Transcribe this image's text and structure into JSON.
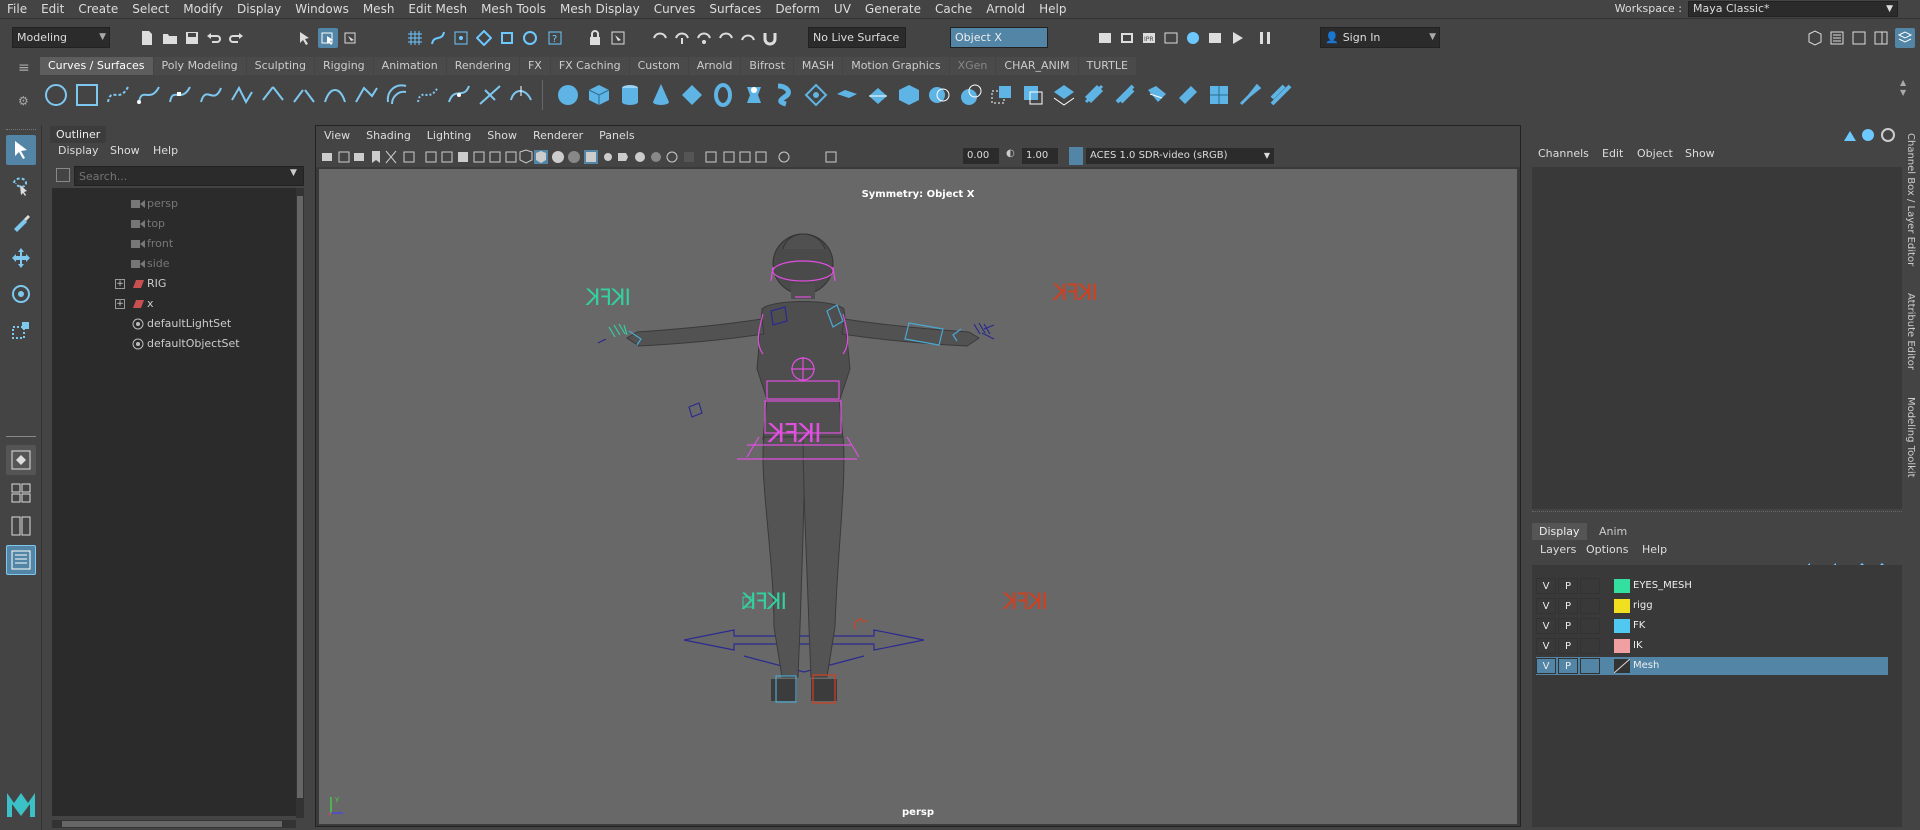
{
  "menubar": [
    "File",
    "Edit",
    "Create",
    "Select",
    "Modify",
    "Display",
    "Windows",
    "Mesh",
    "Edit Mesh",
    "Mesh Tools",
    "Mesh Display",
    "Curves",
    "Surfaces",
    "Deform",
    "UV",
    "Generate",
    "Cache",
    "Arnold",
    "Help"
  ],
  "workspace": {
    "label": "Workspace :",
    "value": "Maya Classic*"
  },
  "status": {
    "mode": "Modeling",
    "live_surface": "No Live Surface",
    "symmetry": "Object X",
    "sign_in": "Sign In"
  },
  "shelf_tabs": [
    "Curves / Surfaces",
    "Poly Modeling",
    "Sculpting",
    "Rigging",
    "Animation",
    "Rendering",
    "FX",
    "FX Caching",
    "Custom",
    "Arnold",
    "Bifrost",
    "MASH",
    "Motion Graphics",
    "XGen",
    "CHAR_ANIM",
    "TURTLE"
  ],
  "outliner": {
    "title": "Outliner",
    "menu": [
      "Display",
      "Show",
      "Help"
    ],
    "search_placeholder": "Search...",
    "items": [
      {
        "label": "persp",
        "dim": true
      },
      {
        "label": "top",
        "dim": true
      },
      {
        "label": "front",
        "dim": true
      },
      {
        "label": "side",
        "dim": true
      },
      {
        "label": "RIG",
        "dim": false
      },
      {
        "label": "x",
        "dim": false
      },
      {
        "label": "defaultLightSet",
        "dim": false
      },
      {
        "label": "defaultObjectSet",
        "dim": false
      }
    ]
  },
  "viewport": {
    "menu": [
      "View",
      "Shading",
      "Lighting",
      "Show",
      "Renderer",
      "Panels"
    ],
    "val1": "0.00",
    "val2": "1.00",
    "colorspace": "ACES 1.0 SDR-video (sRGB)",
    "symmetry_label": "Symmetry: Object X",
    "camera": "persp",
    "ikfk": "IKFK"
  },
  "channelbox": {
    "menu": [
      "Channels",
      "Edit",
      "Object",
      "Show"
    ]
  },
  "layers": {
    "tabs": [
      "Display",
      "Anim"
    ],
    "menu": [
      "Layers",
      "Options",
      "Help"
    ],
    "rows": [
      {
        "v": "V",
        "p": "P",
        "name": "EYES_MESH",
        "color": "#33e0a0"
      },
      {
        "v": "V",
        "p": "P",
        "name": "rigg",
        "color": "#f0e020"
      },
      {
        "v": "V",
        "p": "P",
        "name": "FK",
        "color": "#50c8f0"
      },
      {
        "v": "V",
        "p": "P",
        "name": "IK",
        "color": "#f0a0a0"
      },
      {
        "v": "V",
        "p": "P",
        "name": "Mesh",
        "color": "#333333"
      }
    ]
  },
  "side_tabs": [
    "Channel Box / Layer Editor",
    "Attribute Editor",
    "Modeling Toolkit"
  ]
}
